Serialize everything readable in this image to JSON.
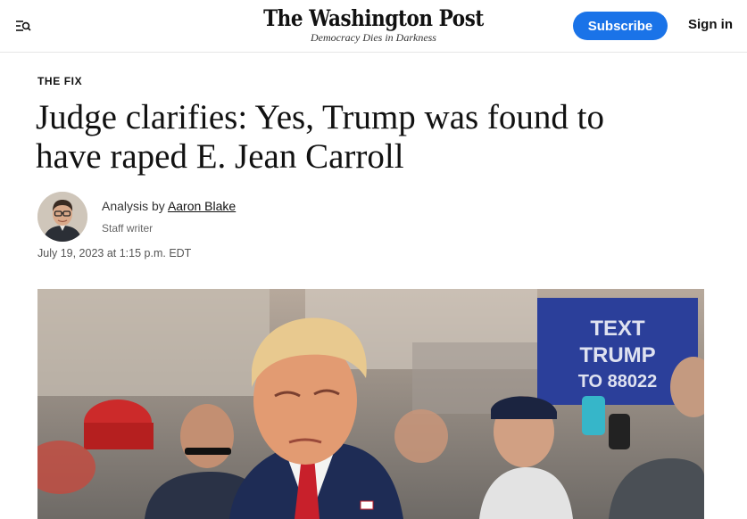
{
  "header": {
    "logo": "The Washington Post",
    "tagline": "Democracy Dies in Darkness",
    "subscribe_label": "Subscribe",
    "signin_label": "Sign in",
    "menu_icon": "menu-search-icon",
    "accent_color": "#1a73e8"
  },
  "article": {
    "kicker": "THE FIX",
    "headline": "Judge clarifies: Yes, Trump was found to have raped E. Jean Carroll",
    "byline_prefix": "Analysis by",
    "author": "Aaron Blake",
    "author_role": "Staff writer",
    "timestamp": "July 19, 2023 at 1:15 p.m. EDT"
  },
  "hero_image": {
    "sign_text": [
      "TEXT",
      "TRUMP",
      "TO 88022"
    ]
  }
}
